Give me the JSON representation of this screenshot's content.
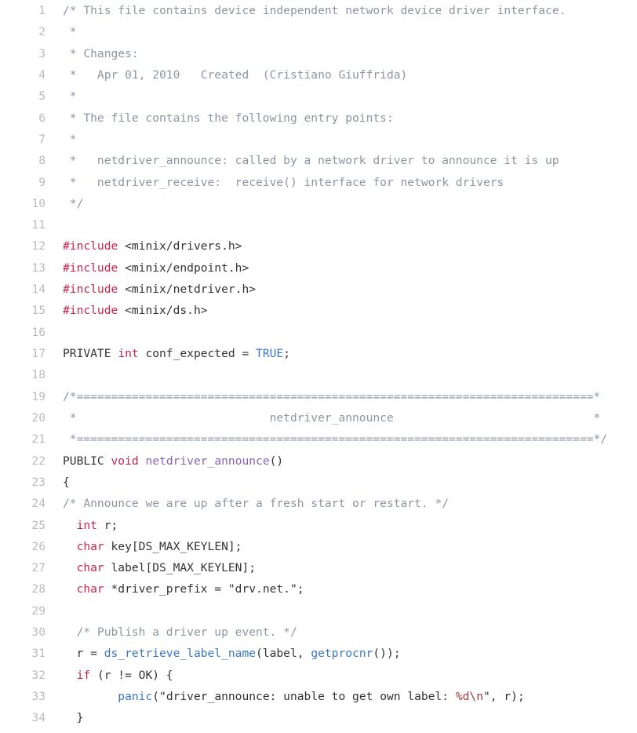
{
  "editor": {
    "name": "code-viewer",
    "language": "c",
    "colors": {
      "background": "#ffffff",
      "text": "#333333",
      "line_number": "#b8bcc2",
      "comment": "#8c96a3",
      "keyword": "#c7254e",
      "preprocessor": "#c7254e",
      "constant": "#3b77c2",
      "function_call": "#3b77c2",
      "function_def": "#8a63b5",
      "string": "#333333",
      "escape": "#a33b3b"
    },
    "first_line": 1,
    "last_line": 34
  },
  "lines": [
    {
      "n": "1",
      "tokens": [
        {
          "t": "/* This file contains device independent network device driver interface.",
          "c": "comment"
        }
      ]
    },
    {
      "n": "2",
      "tokens": [
        {
          "t": " *",
          "c": "comment"
        }
      ]
    },
    {
      "n": "3",
      "tokens": [
        {
          "t": " * Changes:",
          "c": "comment"
        }
      ]
    },
    {
      "n": "4",
      "tokens": [
        {
          "t": " *   Apr 01, 2010   Created  (Cristiano Giuffrida)",
          "c": "comment"
        }
      ]
    },
    {
      "n": "5",
      "tokens": [
        {
          "t": " *",
          "c": "comment"
        }
      ]
    },
    {
      "n": "6",
      "tokens": [
        {
          "t": " * The file contains the following entry points:",
          "c": "comment"
        }
      ]
    },
    {
      "n": "7",
      "tokens": [
        {
          "t": " *",
          "c": "comment"
        }
      ]
    },
    {
      "n": "8",
      "tokens": [
        {
          "t": " *   netdriver_announce: called by a network driver to announce it is up",
          "c": "comment"
        }
      ]
    },
    {
      "n": "9",
      "tokens": [
        {
          "t": " *   netdriver_receive:  receive() interface for network drivers",
          "c": "comment"
        }
      ]
    },
    {
      "n": "10",
      "tokens": [
        {
          "t": " */",
          "c": "comment"
        }
      ]
    },
    {
      "n": "11",
      "tokens": [
        {
          "t": "",
          "c": "plain"
        }
      ]
    },
    {
      "n": "12",
      "tokens": [
        {
          "t": "#include",
          "c": "preproc"
        },
        {
          "t": " <minix/drivers.h>",
          "c": "plain"
        }
      ]
    },
    {
      "n": "13",
      "tokens": [
        {
          "t": "#include",
          "c": "preproc"
        },
        {
          "t": " <minix/endpoint.h>",
          "c": "plain"
        }
      ]
    },
    {
      "n": "14",
      "tokens": [
        {
          "t": "#include",
          "c": "preproc"
        },
        {
          "t": " <minix/netdriver.h>",
          "c": "plain"
        }
      ]
    },
    {
      "n": "15",
      "tokens": [
        {
          "t": "#include",
          "c": "preproc"
        },
        {
          "t": " <minix/ds.h>",
          "c": "plain"
        }
      ]
    },
    {
      "n": "16",
      "tokens": [
        {
          "t": "",
          "c": "plain"
        }
      ]
    },
    {
      "n": "17",
      "tokens": [
        {
          "t": "PRIVATE ",
          "c": "plain"
        },
        {
          "t": "int",
          "c": "keyword"
        },
        {
          "t": " conf_expected = ",
          "c": "plain"
        },
        {
          "t": "TRUE",
          "c": "constant"
        },
        {
          "t": ";",
          "c": "plain"
        }
      ]
    },
    {
      "n": "18",
      "tokens": [
        {
          "t": "",
          "c": "plain"
        }
      ]
    },
    {
      "n": "19",
      "tokens": [
        {
          "t": "/*===========================================================================*",
          "c": "comment"
        }
      ]
    },
    {
      "n": "20",
      "tokens": [
        {
          "t": " *                            netdriver_announce                             *",
          "c": "comment"
        }
      ]
    },
    {
      "n": "21",
      "tokens": [
        {
          "t": " *===========================================================================*/",
          "c": "comment"
        }
      ]
    },
    {
      "n": "22",
      "tokens": [
        {
          "t": "PUBLIC ",
          "c": "plain"
        },
        {
          "t": "void",
          "c": "keyword"
        },
        {
          "t": " ",
          "c": "plain"
        },
        {
          "t": "netdriver_announce",
          "c": "deffun"
        },
        {
          "t": "()",
          "c": "plain"
        }
      ]
    },
    {
      "n": "23",
      "tokens": [
        {
          "t": "{",
          "c": "plain"
        }
      ]
    },
    {
      "n": "24",
      "tokens": [
        {
          "t": "/* Announce we are up after a fresh start or restart. */",
          "c": "comment"
        }
      ]
    },
    {
      "n": "25",
      "tokens": [
        {
          "t": "  ",
          "c": "plain"
        },
        {
          "t": "int",
          "c": "keyword"
        },
        {
          "t": " r;",
          "c": "plain"
        }
      ]
    },
    {
      "n": "26",
      "tokens": [
        {
          "t": "  ",
          "c": "plain"
        },
        {
          "t": "char",
          "c": "keyword"
        },
        {
          "t": " key[DS_MAX_KEYLEN];",
          "c": "plain"
        }
      ]
    },
    {
      "n": "27",
      "tokens": [
        {
          "t": "  ",
          "c": "plain"
        },
        {
          "t": "char",
          "c": "keyword"
        },
        {
          "t": " label[DS_MAX_KEYLEN];",
          "c": "plain"
        }
      ]
    },
    {
      "n": "28",
      "tokens": [
        {
          "t": "  ",
          "c": "plain"
        },
        {
          "t": "char",
          "c": "keyword"
        },
        {
          "t": " *driver_prefix = ",
          "c": "plain"
        },
        {
          "t": "\"drv.net.\"",
          "c": "string"
        },
        {
          "t": ";",
          "c": "plain"
        }
      ]
    },
    {
      "n": "29",
      "tokens": [
        {
          "t": "",
          "c": "plain"
        }
      ]
    },
    {
      "n": "30",
      "tokens": [
        {
          "t": "  ",
          "c": "plain"
        },
        {
          "t": "/* Publish a driver up event. */",
          "c": "comment"
        }
      ]
    },
    {
      "n": "31",
      "tokens": [
        {
          "t": "  r = ",
          "c": "plain"
        },
        {
          "t": "ds_retrieve_label_name",
          "c": "function"
        },
        {
          "t": "(label, ",
          "c": "plain"
        },
        {
          "t": "getprocnr",
          "c": "function"
        },
        {
          "t": "());",
          "c": "plain"
        }
      ]
    },
    {
      "n": "32",
      "tokens": [
        {
          "t": "  ",
          "c": "plain"
        },
        {
          "t": "if",
          "c": "keyword"
        },
        {
          "t": " (r != OK) {",
          "c": "plain"
        }
      ]
    },
    {
      "n": "33",
      "tokens": [
        {
          "t": "        ",
          "c": "plain"
        },
        {
          "t": "panic",
          "c": "function"
        },
        {
          "t": "(",
          "c": "plain"
        },
        {
          "t": "\"driver_announce: unable to get own label: ",
          "c": "string"
        },
        {
          "t": "%d\\n",
          "c": "escape"
        },
        {
          "t": "\"",
          "c": "string"
        },
        {
          "t": ", r);",
          "c": "plain"
        }
      ]
    },
    {
      "n": "34",
      "tokens": [
        {
          "t": "  }",
          "c": "plain"
        }
      ]
    }
  ]
}
